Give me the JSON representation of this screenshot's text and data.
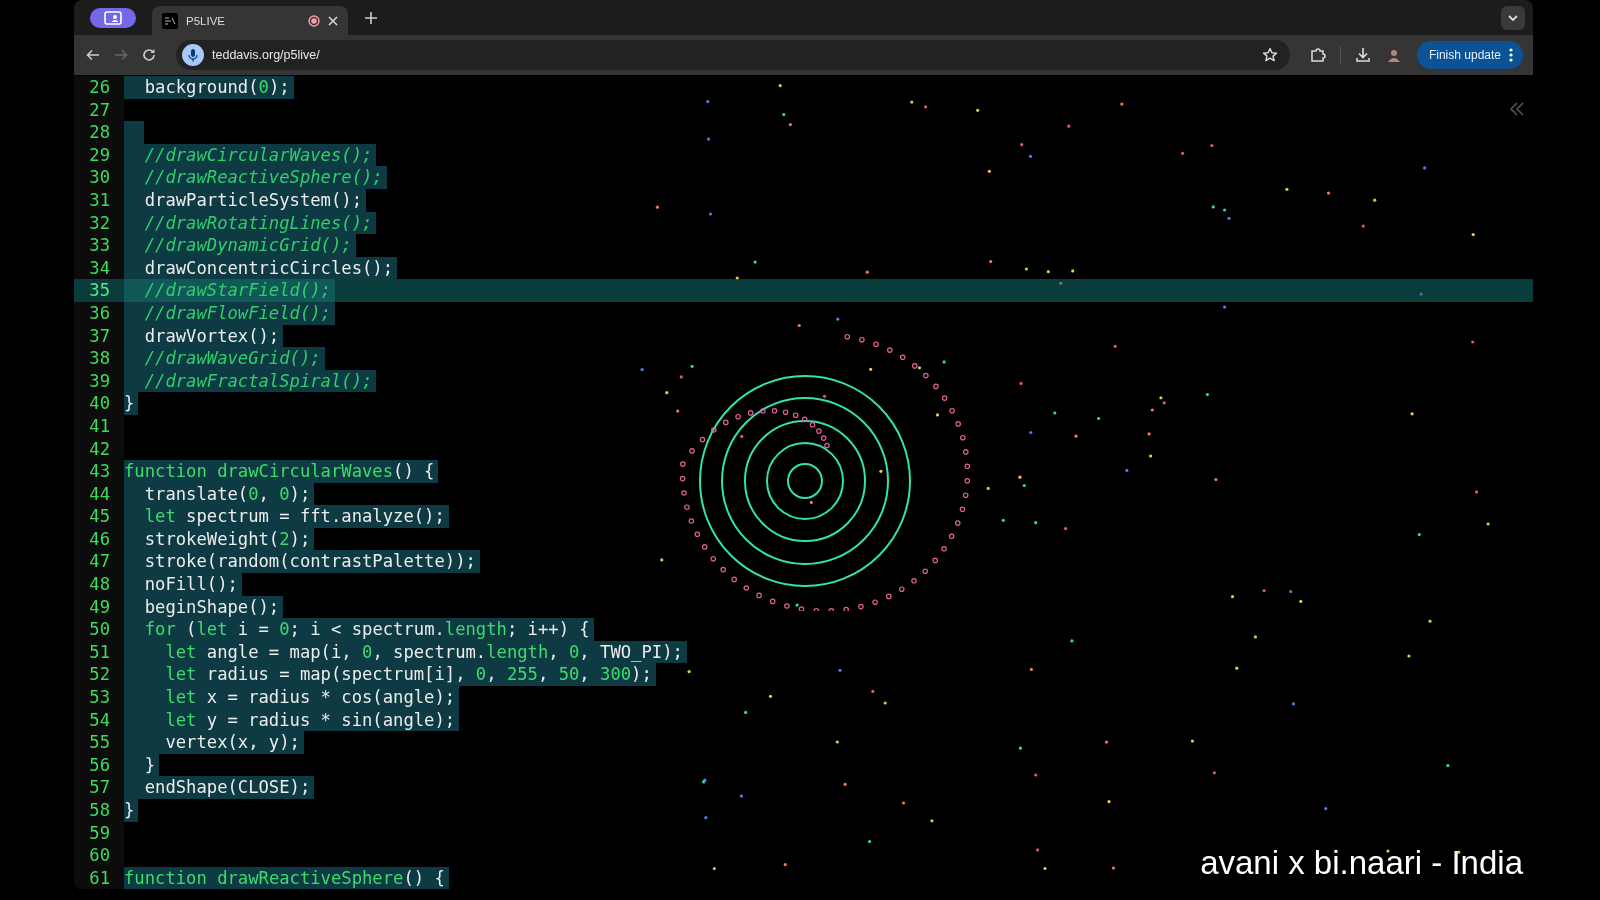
{
  "tabs": [
    {
      "title": "P5LIVE",
      "selected": true
    }
  ],
  "address_bar": {
    "url": "teddavis.org/p5live/"
  },
  "update_button": {
    "label": "Finish update"
  },
  "editor": {
    "lines": [
      {
        "number": "26",
        "selected": true,
        "active": false,
        "tokens": [
          {
            "kind": "text",
            "text": "  background("
          },
          {
            "kind": "number",
            "text": "0"
          },
          {
            "kind": "text",
            "text": ");"
          }
        ]
      },
      {
        "number": "27",
        "selected": false,
        "active": false
      },
      {
        "number": "28",
        "selected": true,
        "active": false
      },
      {
        "number": "29",
        "selected": true,
        "active": false,
        "tokens": [
          {
            "kind": "comment",
            "text": "  //drawCircularWaves();"
          }
        ]
      },
      {
        "number": "30",
        "selected": true,
        "active": false,
        "tokens": [
          {
            "kind": "comment",
            "text": "  //drawReactiveSphere();"
          }
        ]
      },
      {
        "number": "31",
        "selected": true,
        "active": false,
        "tokens": [
          {
            "kind": "text",
            "text": "  drawParticleSystem();"
          }
        ]
      },
      {
        "number": "32",
        "selected": true,
        "active": false,
        "tokens": [
          {
            "kind": "comment",
            "text": "  //drawRotatingLines();"
          }
        ]
      },
      {
        "number": "33",
        "selected": true,
        "active": false,
        "tokens": [
          {
            "kind": "comment",
            "text": "  //drawDynamicGrid();"
          }
        ]
      },
      {
        "number": "34",
        "selected": true,
        "active": false,
        "tokens": [
          {
            "kind": "text",
            "text": "  drawConcentricCircles();"
          }
        ]
      },
      {
        "number": "35",
        "selected": true,
        "active": true,
        "tokens": [
          {
            "kind": "comment",
            "text": "  //drawStarField();"
          }
        ]
      },
      {
        "number": "36",
        "selected": true,
        "active": false,
        "tokens": [
          {
            "kind": "comment",
            "text": "  //drawFlowField();"
          }
        ]
      },
      {
        "number": "37",
        "selected": true,
        "active": false,
        "tokens": [
          {
            "kind": "text",
            "text": "  drawVortex();"
          }
        ]
      },
      {
        "number": "38",
        "selected": true,
        "active": false,
        "tokens": [
          {
            "kind": "comment",
            "text": "  //drawWaveGrid();"
          }
        ]
      },
      {
        "number": "39",
        "selected": true,
        "active": false,
        "tokens": [
          {
            "kind": "comment",
            "text": "  //drawFractalSpiral();"
          }
        ]
      },
      {
        "number": "40",
        "selected": true,
        "active": false,
        "tokens": [
          {
            "kind": "text",
            "text": "}"
          }
        ]
      },
      {
        "number": "41",
        "selected": false,
        "active": false
      },
      {
        "number": "42",
        "selected": false,
        "active": false
      },
      {
        "number": "43",
        "selected": true,
        "active": false,
        "tokens": [
          {
            "kind": "keyword",
            "text": "function"
          },
          {
            "kind": "keyword",
            "text": " drawCircularWaves"
          },
          {
            "kind": "text",
            "text": "() {"
          }
        ]
      },
      {
        "number": "44",
        "selected": true,
        "active": false,
        "tokens": [
          {
            "kind": "text",
            "text": "  translate("
          },
          {
            "kind": "number",
            "text": "0"
          },
          {
            "kind": "text",
            "text": ", "
          },
          {
            "kind": "number",
            "text": "0"
          },
          {
            "kind": "text",
            "text": ");"
          }
        ]
      },
      {
        "number": "45",
        "selected": true,
        "active": false,
        "tokens": [
          {
            "kind": "keyword",
            "text": "  let"
          },
          {
            "kind": "text",
            "text": " spectrum = fft.analyze();"
          }
        ]
      },
      {
        "number": "46",
        "selected": true,
        "active": false,
        "tokens": [
          {
            "kind": "text",
            "text": "  strokeWeight("
          },
          {
            "kind": "number",
            "text": "2"
          },
          {
            "kind": "text",
            "text": ");"
          }
        ]
      },
      {
        "number": "47",
        "selected": true,
        "active": false,
        "tokens": [
          {
            "kind": "text",
            "text": "  stroke(random(contrastPalette));"
          }
        ]
      },
      {
        "number": "48",
        "selected": true,
        "active": false,
        "tokens": [
          {
            "kind": "text",
            "text": "  noFill();"
          }
        ]
      },
      {
        "number": "49",
        "selected": true,
        "active": false,
        "tokens": [
          {
            "kind": "text",
            "text": "  beginShape();"
          }
        ]
      },
      {
        "number": "50",
        "selected": true,
        "active": false,
        "tokens": [
          {
            "kind": "keyword",
            "text": "  for"
          },
          {
            "kind": "text",
            "text": " ("
          },
          {
            "kind": "keyword",
            "text": "let"
          },
          {
            "kind": "text",
            "text": " i = "
          },
          {
            "kind": "number",
            "text": "0"
          },
          {
            "kind": "text",
            "text": "; i < spectrum."
          },
          {
            "kind": "keyword",
            "text": "length"
          },
          {
            "kind": "text",
            "text": "; i++) {"
          }
        ]
      },
      {
        "number": "51",
        "selected": true,
        "active": false,
        "tokens": [
          {
            "kind": "keyword",
            "text": "    let"
          },
          {
            "kind": "text",
            "text": " angle = map(i, "
          },
          {
            "kind": "number",
            "text": "0"
          },
          {
            "kind": "text",
            "text": ", spectrum."
          },
          {
            "kind": "keyword",
            "text": "length"
          },
          {
            "kind": "text",
            "text": ", "
          },
          {
            "kind": "number",
            "text": "0"
          },
          {
            "kind": "text",
            "text": ", TWO_PI);"
          }
        ]
      },
      {
        "number": "52",
        "selected": true,
        "active": false,
        "tokens": [
          {
            "kind": "keyword",
            "text": "    let"
          },
          {
            "kind": "text",
            "text": " radius = map(spectrum[i], "
          },
          {
            "kind": "number",
            "text": "0"
          },
          {
            "kind": "text",
            "text": ", "
          },
          {
            "kind": "number",
            "text": "255"
          },
          {
            "kind": "text",
            "text": ", "
          },
          {
            "kind": "number",
            "text": "50"
          },
          {
            "kind": "text",
            "text": ", "
          },
          {
            "kind": "number",
            "text": "300"
          },
          {
            "kind": "text",
            "text": ");"
          }
        ]
      },
      {
        "number": "53",
        "selected": true,
        "active": false,
        "tokens": [
          {
            "kind": "keyword",
            "text": "    let"
          },
          {
            "kind": "text",
            "text": " x = radius * cos(angle);"
          }
        ]
      },
      {
        "number": "54",
        "selected": true,
        "active": false,
        "tokens": [
          {
            "kind": "keyword",
            "text": "    let"
          },
          {
            "kind": "text",
            "text": " y = radius * sin(angle);"
          }
        ]
      },
      {
        "number": "55",
        "selected": true,
        "active": false,
        "tokens": [
          {
            "kind": "text",
            "text": "    vertex(x, y);"
          }
        ]
      },
      {
        "number": "56",
        "selected": true,
        "active": false,
        "tokens": [
          {
            "kind": "text",
            "text": "  }"
          }
        ]
      },
      {
        "number": "57",
        "selected": true,
        "active": false,
        "tokens": [
          {
            "kind": "text",
            "text": "  endShape(CLOSE);"
          }
        ]
      },
      {
        "number": "58",
        "selected": true,
        "active": false,
        "tokens": [
          {
            "kind": "text",
            "text": "}"
          }
        ]
      },
      {
        "number": "59",
        "selected": false,
        "active": false
      },
      {
        "number": "60",
        "selected": false,
        "active": false
      },
      {
        "number": "61",
        "selected": true,
        "active": false,
        "tokens": [
          {
            "kind": "keyword",
            "text": "function"
          },
          {
            "kind": "keyword",
            "text": " drawReactiveSphere"
          },
          {
            "kind": "text",
            "text": "() {"
          }
        ]
      }
    ]
  },
  "caption": "avani x bi.naari - India"
}
